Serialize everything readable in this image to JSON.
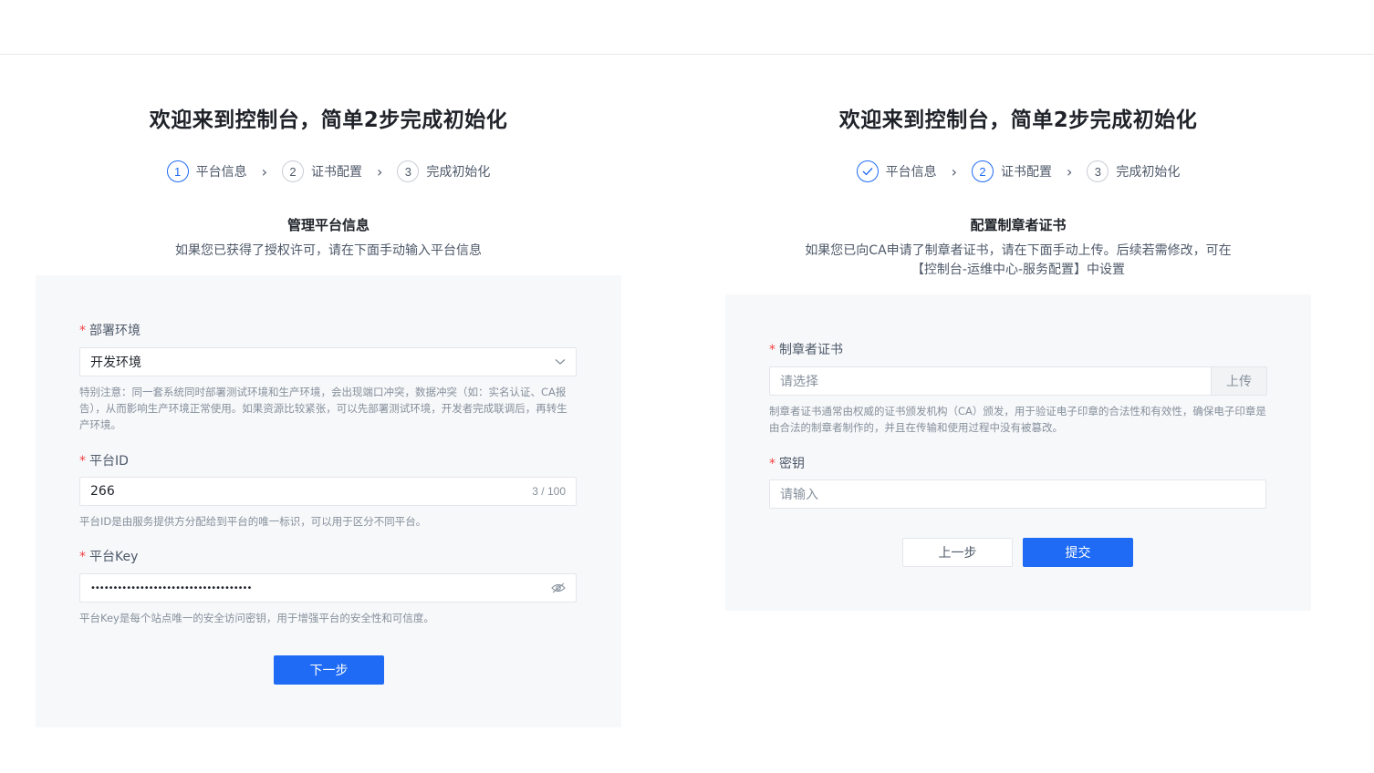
{
  "left": {
    "title": "欢迎来到控制台，简单2步完成初始化",
    "steps": [
      {
        "num": "1",
        "label": "平台信息"
      },
      {
        "num": "2",
        "label": "证书配置"
      },
      {
        "num": "3",
        "label": "完成初始化"
      }
    ],
    "section_title": "管理平台信息",
    "section_desc": "如果您已获得了授权许可，请在下面手动输入平台信息",
    "env": {
      "label": "部署环境",
      "value": "开发环境",
      "help": "特别注意：同一套系统同时部署测试环境和生产环境，会出现端口冲突，数据冲突（如：实名认证、CA报告），从而影响生产环境正常使用。如果资源比较紧张，可以先部署测试环境，开发者完成联调后，再转生产环境。"
    },
    "platform_id": {
      "label": "平台ID",
      "value": "266",
      "counter": "3 / 100",
      "help": "平台ID是由服务提供方分配给到平台的唯一标识，可以用于区分不同平台。"
    },
    "platform_key": {
      "label": "平台Key",
      "value": "••••••••••••••••••••••••••••••••••••",
      "help": "平台Key是每个站点唯一的安全访问密钥，用于增强平台的安全性和可信度。"
    },
    "next_label": "下一步"
  },
  "right": {
    "title": "欢迎来到控制台，简单2步完成初始化",
    "steps": [
      {
        "num": "✓",
        "label": "平台信息"
      },
      {
        "num": "2",
        "label": "证书配置"
      },
      {
        "num": "3",
        "label": "完成初始化"
      }
    ],
    "section_title": "配置制章者证书",
    "section_desc_1": "如果您已向CA申请了制章者证书，请在下面手动上传。后续若需修改，可在",
    "section_desc_2": "【控制台-运维中心-服务配置】中设置",
    "cert": {
      "label": "制章者证书",
      "placeholder": "请选择",
      "upload_label": "上传",
      "help": "制章者证书通常由权威的证书颁发机构（CA）颁发，用于验证电子印章的合法性和有效性，确保电子印章是由合法的制章者制作的，并且在传输和使用过程中没有被篡改。"
    },
    "secret": {
      "label": "密钥",
      "placeholder": "请输入"
    },
    "prev_label": "上一步",
    "submit_label": "提交"
  },
  "colors": {
    "primary": "#1f6bf5",
    "required": "#f53f3f",
    "card_bg": "#f7f8fa"
  }
}
